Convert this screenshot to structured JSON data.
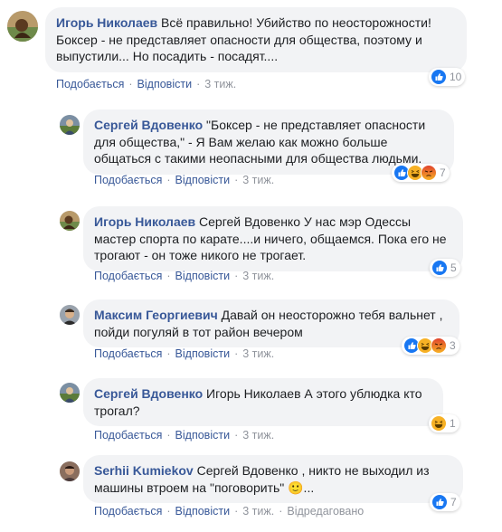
{
  "actions": {
    "like": "Подобається",
    "reply": "Відповісти",
    "sep": "·"
  },
  "comments": [
    {
      "author": "Игорь Николаев",
      "text": "Всё правильно! Убийство по неосторожности! Боксер - не представляет опасности для общества, поэтому и выпустили... Но посадить - посадят....",
      "time": "3 тиж.",
      "reactions": [
        "like-icon"
      ],
      "count": "10"
    },
    {
      "author": "Сергей Вдовенко",
      "text": "\"Боксер - не представляет опасности для общества,\" - Я Вам желаю как можно больше общаться с такими неопасными для общества людьми.",
      "time": "3 тиж.",
      "reactions": [
        "like-icon",
        "haha-icon",
        "angry-icon"
      ],
      "count": "7"
    },
    {
      "author": "Игорь Николаев",
      "text": "Сергей Вдовенко У нас мэр Одессы мастер спорта по карате....и ничего, общаемся. Пока его не трогают - он тоже никого не трогает.",
      "time": "3 тиж.",
      "reactions": [
        "like-icon"
      ],
      "count": "5"
    },
    {
      "author": "Максим Георгиевич",
      "text": "Давай он неосторожно тебя вальнет , пойди погуляй в тот район вечером",
      "time": "3 тиж.",
      "reactions": [
        "like-icon",
        "haha-icon",
        "angry-icon"
      ],
      "count": "3"
    },
    {
      "author": "Сергей Вдовенко",
      "text": "Игорь Николаев А этого ублюдка кто трогал?",
      "time": "3 тиж.",
      "reactions": [
        "haha-icon"
      ],
      "count": "1"
    },
    {
      "author": "Serhii Kumiekov",
      "text": "Сергей Вдовенко , никто не выходил из машины втроем на \"поговорить\" 🙂...",
      "time": "3 тиж.",
      "edited": "Відредаговано",
      "reactions": [
        "like-icon"
      ],
      "count": "7"
    }
  ],
  "colors": {
    "link": "#385898",
    "bubble": "#f2f3f5",
    "muted": "#90949c",
    "like": "#1877f2",
    "haha": "#f7b125",
    "angry": "#e9710f"
  }
}
